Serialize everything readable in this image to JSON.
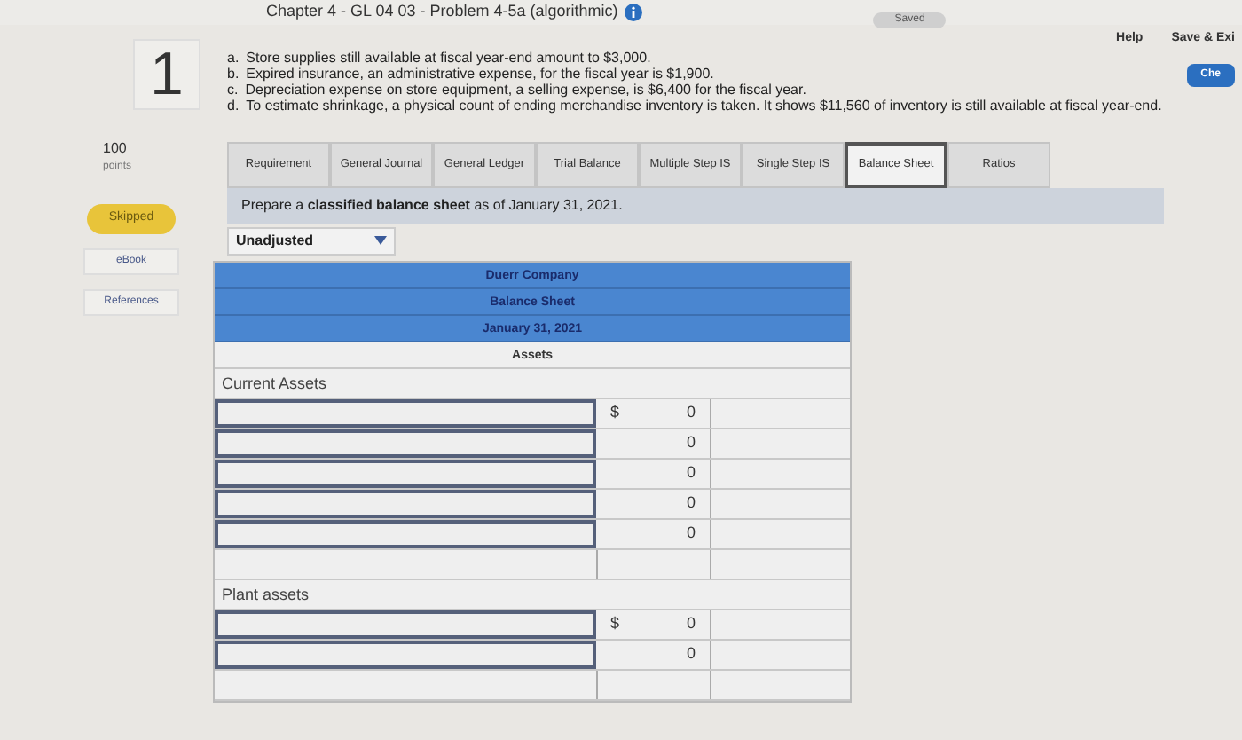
{
  "header": {
    "title": "Chapter 4 - GL 04 03 - Problem 4-5a (algorithmic)",
    "status": "Saved",
    "links": [
      "Help",
      "Save & Exi"
    ],
    "side_button": "Che"
  },
  "sidebar": {
    "number": "1",
    "points": "100",
    "points_label": "points",
    "status": "Skipped",
    "links": [
      "eBook",
      "References"
    ]
  },
  "items": [
    {
      "letter": "a.",
      "text": "Store supplies still available at fiscal year-end amount to $3,000."
    },
    {
      "letter": "b.",
      "text": "Expired insurance, an administrative expense, for the fiscal year is $1,900."
    },
    {
      "letter": "c.",
      "text": "Depreciation expense on store equipment, a selling expense, is $6,400 for the fiscal year."
    },
    {
      "letter": "d.",
      "text": "To estimate shrinkage, a physical count of ending merchandise inventory is taken. It shows $11,560 of inventory is still available at fiscal year-end."
    }
  ],
  "tabs": [
    {
      "label": "Requirement",
      "selected": false
    },
    {
      "label": "General Journal",
      "selected": false
    },
    {
      "label": "General Ledger",
      "selected": false
    },
    {
      "label": "Trial Balance",
      "selected": false
    },
    {
      "label": "Multiple Step IS",
      "selected": false
    },
    {
      "label": "Single Step IS",
      "selected": false
    },
    {
      "label": "Balance Sheet",
      "selected": true
    },
    {
      "label": "Ratios",
      "selected": false
    }
  ],
  "instruction": "Prepare a **classified balance sheet** as of January 31, 2021.",
  "dropdown": {
    "value": "Unadjusted"
  },
  "table": {
    "headers": [
      "Duerr Company",
      "Balance Sheet",
      "January 31, 2021"
    ],
    "section": "Assets",
    "rows": [
      {
        "kind": "label",
        "text": "Current Assets"
      },
      {
        "kind": "input",
        "currency": "$",
        "amount": "0"
      },
      {
        "kind": "input",
        "amount": "0"
      },
      {
        "kind": "input",
        "amount": "0"
      },
      {
        "kind": "input",
        "amount": "0"
      },
      {
        "kind": "input",
        "amount": "0"
      },
      {
        "kind": "blank"
      },
      {
        "kind": "label",
        "text": "Plant assets"
      },
      {
        "kind": "input",
        "currency": "$",
        "amount": "0"
      },
      {
        "kind": "input",
        "amount": "0"
      },
      {
        "kind": "blank"
      }
    ]
  }
}
